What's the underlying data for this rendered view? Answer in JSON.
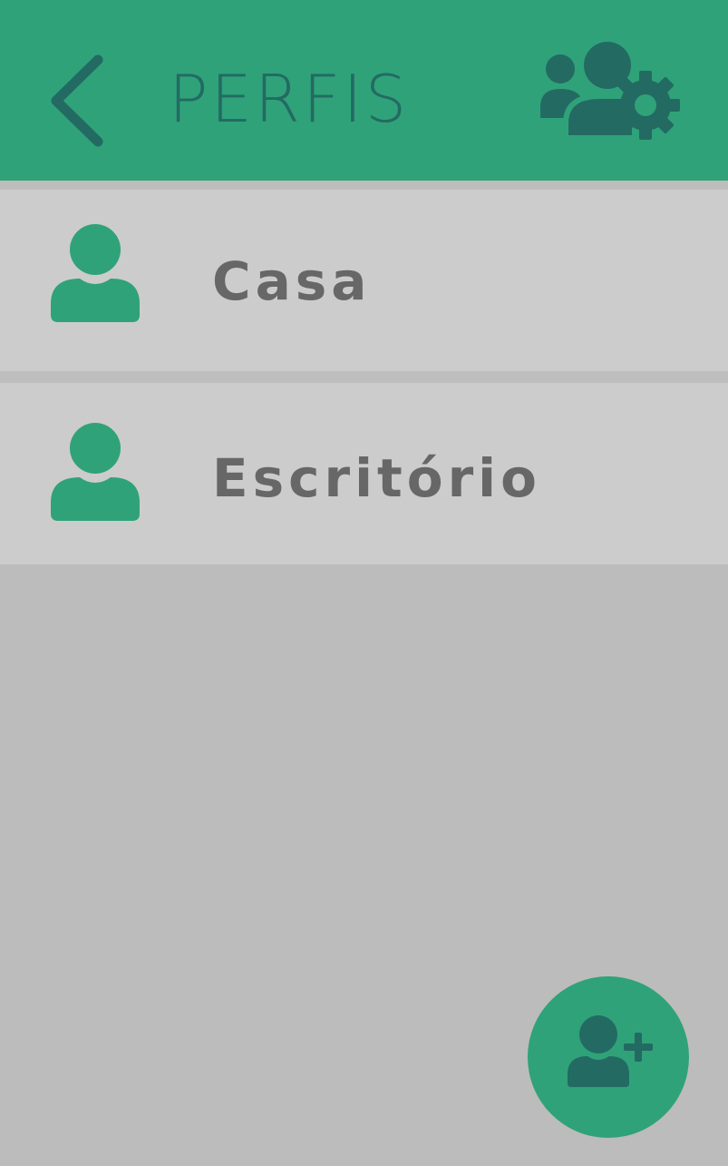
{
  "header": {
    "title": "PERFIS",
    "back_icon": "chevron-left-icon",
    "settings_icon": "users-gear-icon"
  },
  "profiles": [
    {
      "label": "Casa",
      "icon": "user-icon"
    },
    {
      "label": "Escritório",
      "icon": "user-icon"
    }
  ],
  "fab": {
    "icon": "user-plus-icon"
  },
  "colors": {
    "brand_green": "#2fa279",
    "icon_dark": "#236a62",
    "row_background": "#cccccc",
    "page_background": "#bcbcbc",
    "label_text": "#676767"
  }
}
